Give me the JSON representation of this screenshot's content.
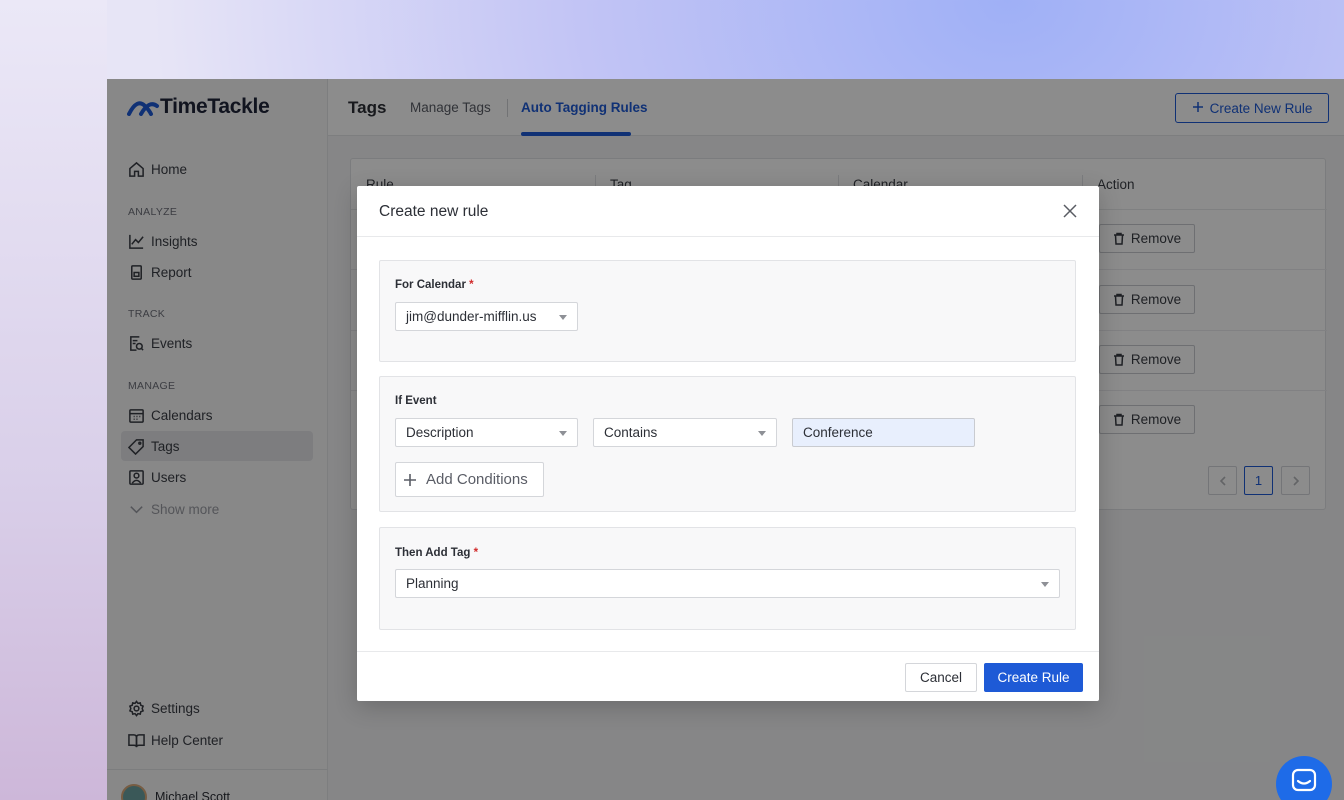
{
  "app": {
    "brand": "TimeTackle"
  },
  "sidebar": {
    "home": "Home",
    "sections": {
      "analyze": "ANALYZE",
      "track": "TRACK",
      "manage": "MANAGE"
    },
    "items": {
      "insights": "Insights",
      "report": "Report",
      "events": "Events",
      "calendars": "Calendars",
      "tags": "Tags",
      "users": "Users",
      "show_more": "Show more",
      "settings": "Settings",
      "help_center": "Help Center"
    },
    "user_name": "Michael Scott"
  },
  "topbar": {
    "title": "Tags",
    "tabs": [
      "Manage Tags",
      "Auto Tagging Rules"
    ],
    "active_tab": "Auto Tagging Rules",
    "create_button": "Create New Rule"
  },
  "table": {
    "headers": [
      "Rule",
      "Tag",
      "Calendar",
      "Action"
    ],
    "rows": [
      {
        "action": "Remove"
      },
      {
        "action": "Remove"
      },
      {
        "action": "Remove"
      },
      {
        "action": "Remove"
      }
    ],
    "pagination": {
      "current_page": "1"
    }
  },
  "modal": {
    "title": "Create new rule",
    "for_calendar": {
      "label": "For Calendar",
      "required_mark": "*",
      "value": "jim@dunder-mifflin.us"
    },
    "if_event": {
      "label": "If Event",
      "field": "Description",
      "operator": "Contains",
      "value": "Conference",
      "add_conditions": "Add Conditions"
    },
    "then_add_tag": {
      "label": "Then Add Tag",
      "required_mark": "*",
      "value": "Planning"
    },
    "cancel": "Cancel",
    "submit": "Create Rule"
  },
  "colors": {
    "primary": "#1e5ad6",
    "required": "#d12b2b",
    "chat": "#1e6be8"
  }
}
